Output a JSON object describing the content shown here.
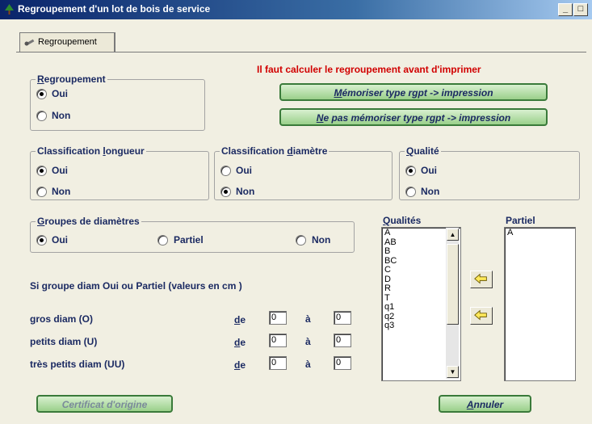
{
  "window": {
    "title": "Regroupement d'un lot de bois de service",
    "min": "_",
    "max": "□"
  },
  "tab": {
    "label": "Regroupement"
  },
  "warning": "Il faut calculer le regroupement avant d'imprimer",
  "buttons": {
    "memoriser_u": "M",
    "memoriser_rest": "émoriser type rgpt -> impression",
    "ne_pas_u": "N",
    "ne_pas_rest": "e pas mémoriser type rgpt -> impression",
    "certificat": "Certificat d'origine",
    "annuler_u": "A",
    "annuler_rest": "nnuler"
  },
  "regroupement": {
    "legend_u": "R",
    "legend_rest": "egroupement",
    "oui": "Oui",
    "non": "Non",
    "selected": "Oui"
  },
  "class_longueur": {
    "legend_a": "Classification ",
    "legend_u": "l",
    "legend_b": "ongueur",
    "oui": "Oui",
    "non": "Non",
    "selected": "Oui"
  },
  "class_diametre": {
    "legend_a": "Classification ",
    "legend_u": "d",
    "legend_b": "iamètre",
    "oui": "Oui",
    "non": "Non",
    "selected": "Non"
  },
  "qualite": {
    "legend_u": "Q",
    "legend_rest": "ualité",
    "oui": "Oui",
    "non": "Non",
    "selected": "Oui"
  },
  "groupes": {
    "legend_u": "G",
    "legend_rest": "roupes de diamètres",
    "oui": "Oui",
    "partiel": "Partiel",
    "non": "Non",
    "selected": "Oui"
  },
  "info": "Si groupe diam Oui ou Partiel (valeurs en cm )",
  "diam_rows": [
    {
      "label": "gros diam (O)",
      "de_u": "d",
      "de_rest": "e",
      "a": "à",
      "from": "0",
      "to": "0"
    },
    {
      "label": "petits diam (U)",
      "de_u": "d",
      "de_rest": "e",
      "a": "à",
      "from": "0",
      "to": "0"
    },
    {
      "label": "très petits diam (UU)",
      "de_u": "d",
      "de_rest": "e",
      "a": "à",
      "from": "0",
      "to": "0"
    }
  ],
  "qualites": {
    "label_u": "Q",
    "label_rest": "ualités",
    "items": [
      "A",
      "AB",
      "B",
      "BC",
      "C",
      "D",
      "R",
      "T",
      "q1",
      "q2",
      "q3"
    ]
  },
  "partiel": {
    "label": "Partiel",
    "items": [
      "A"
    ]
  },
  "icons": {
    "app": "tree-icon",
    "tab": "tools-icon",
    "move_left": "arrow-left-icon"
  },
  "colors": {
    "title_bar": "#0a246a",
    "warning": "#d10000",
    "button_green": "#9ad08a",
    "arrow_yellow": "#ffe95a"
  }
}
